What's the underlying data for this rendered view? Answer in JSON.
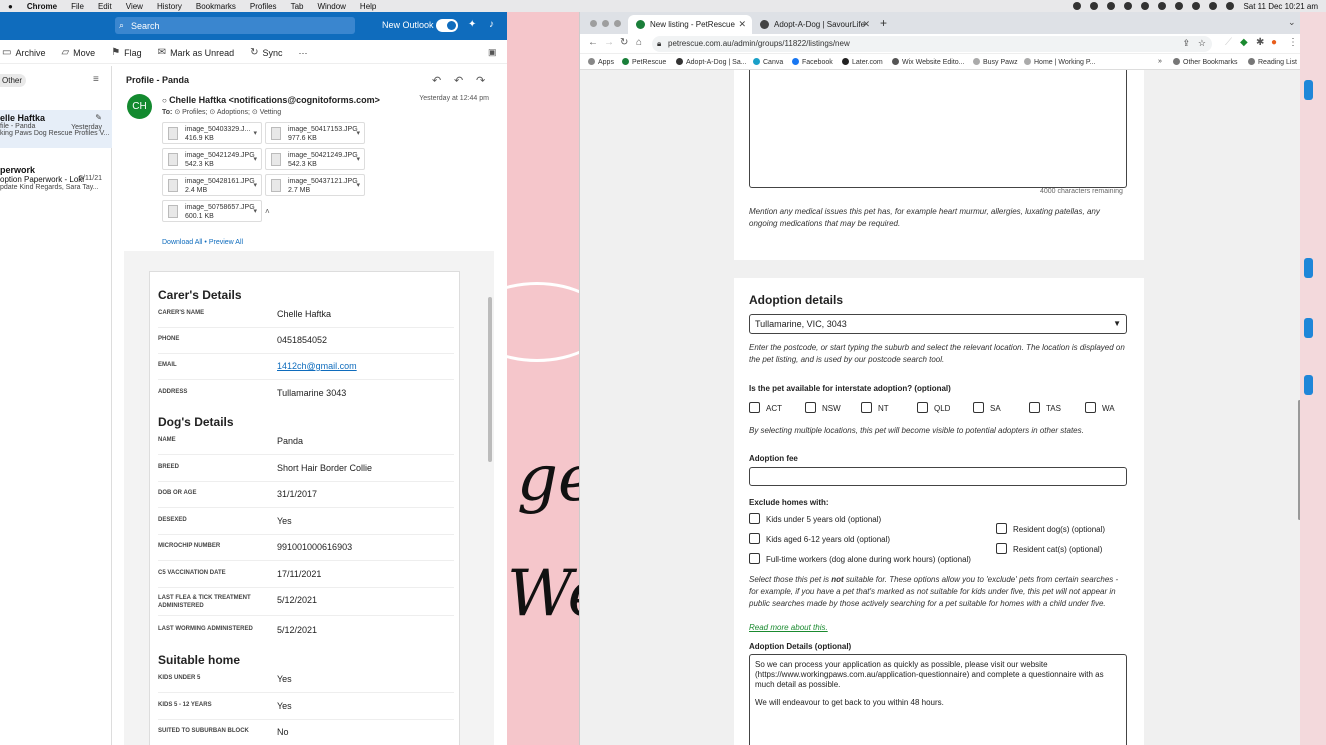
{
  "menubar": {
    "app": "Chrome",
    "items": [
      "File",
      "Edit",
      "View",
      "History",
      "Bookmarks",
      "Profiles",
      "Tab",
      "Window",
      "Help"
    ],
    "clock": "Sat 11 Dec  10:21 am"
  },
  "outlook": {
    "search_placeholder": "Search",
    "new_outlook": "New Outlook",
    "toolbar": {
      "archive": "Archive",
      "move": "Move",
      "flag": "Flag",
      "mark_unread": "Mark as Unread",
      "sync": "Sync",
      "more": "···"
    },
    "folder_pill": "Other",
    "mails": [
      {
        "name": "elle Haftka",
        "line1": "file - Panda",
        "line2": "king Paws Dog Rescue Profiles V...",
        "date": "Yesterday"
      },
      {
        "name": "perwork",
        "line1": "option Paperwork - Loki",
        "line2": "pdate Kind Regards, Sara Tay...",
        "date": "5/11/21"
      }
    ],
    "message": {
      "subject": "Profile - Panda",
      "avatar": "CH",
      "sender": "Chelle Haftka <notifications@cognitoforms.com>",
      "to_label": "To:",
      "recipients": [
        "Profiles;",
        "Adoptions;",
        "Vetting"
      ],
      "timestamp": "Yesterday at 12:44 pm",
      "attachments": [
        {
          "name": "image_50403329.J...",
          "size": "416.9 KB"
        },
        {
          "name": "image_50417153.JPG",
          "size": "977.6 KB"
        },
        {
          "name": "image_50421249.JPG",
          "size": "542.3 KB"
        },
        {
          "name": "image_50421249.JPG",
          "size": "542.3 KB"
        },
        {
          "name": "image_50428161.JPG",
          "size": "2.4 MB"
        },
        {
          "name": "image_50437121.JPG",
          "size": "2.7 MB"
        },
        {
          "name": "image_50758657.JPG",
          "size": "600.1 KB"
        }
      ],
      "download_all": "Download All",
      "preview_all": "• Preview All"
    },
    "form": {
      "carer_title": "Carer's Details",
      "dog_title": "Dog's Details",
      "home_title": "Suitable home",
      "carer": [
        {
          "label": "CARER'S NAME",
          "value": "Chelle Haftka"
        },
        {
          "label": "PHONE",
          "value": "0451854052"
        },
        {
          "label": "EMAIL",
          "value": "1412ch@gmail.com"
        },
        {
          "label": "ADDRESS",
          "value": "Tullamarine 3043"
        }
      ],
      "dog": [
        {
          "label": "NAME",
          "value": "Panda"
        },
        {
          "label": "BREED",
          "value": "Short Hair Border Collie"
        },
        {
          "label": "DOB OR AGE",
          "value": "31/1/2017"
        },
        {
          "label": "DESEXED",
          "value": "Yes"
        },
        {
          "label": "MICROCHIP NUMBER",
          "value": "991001000616903"
        },
        {
          "label": "C5 VACCINATION DATE",
          "value": "17/11/2021"
        },
        {
          "label": "LAST FLEA & TICK TREATMENT ADMINISTERED",
          "value": "5/12/2021"
        },
        {
          "label": "LAST WORMING ADMINISTERED",
          "value": "5/12/2021"
        }
      ],
      "home": [
        {
          "label": "KIDS UNDER 5",
          "value": "Yes"
        },
        {
          "label": "KIDS 5 - 12 YEARS",
          "value": "Yes"
        },
        {
          "label": "SUITED TO SUBURBAN BLOCK",
          "value": "No"
        }
      ]
    }
  },
  "chrome": {
    "tabs": [
      {
        "title": "New listing - PetRescue"
      },
      {
        "title": "Adopt-A-Dog | SavourLife"
      }
    ],
    "url": "petrescue.com.au/admin/groups/11822/listings/new",
    "bookmarks": [
      "Apps",
      "PetRescue",
      "Adopt-A-Dog | Sa...",
      "Canva",
      "Facebook",
      "Later.com",
      "Wix Website Edito...",
      "Busy Pawz",
      "Home | Working P...",
      "Other Bookmarks",
      "Reading List"
    ],
    "page": {
      "chars_remaining": "4000 characters remaining",
      "medical_hint": "Mention any medical issues this pet has, for example heart murmur, allergies, luxating patellas, any ongoing medications that may be required.",
      "adoption_title": "Adoption details",
      "location_value": "Tullamarine, VIC, 3043",
      "location_hint": "Enter the postcode, or start typing the suburb and select the relevant location. The location is displayed on the pet listing, and is used by our postcode search tool.",
      "interstate_label": "Is the pet available for interstate adoption? (optional)",
      "states": [
        "ACT",
        "NSW",
        "NT",
        "QLD",
        "SA",
        "TAS",
        "WA"
      ],
      "interstate_hint": "By selecting multiple locations, this pet will become visible to potential adopters in other states.",
      "fee_label": "Adoption fee",
      "exclude_label": "Exclude homes with:",
      "exclude_left": [
        "Kids under 5 years old (optional)",
        "Kids aged 6-12 years old (optional)",
        "Full-time workers (dog alone during work hours) (optional)"
      ],
      "exclude_right": [
        "Resident dog(s) (optional)",
        "Resident cat(s) (optional)"
      ],
      "exclude_hint_a": "Select those this pet is ",
      "exclude_hint_not": "not",
      "exclude_hint_b": " suitable for. These options allow you to 'exclude' pets from certain searches - for example, if you have a pet that's marked as not suitable for kids under five, this pet will not appear in public searches made by those actively searching for a pet suitable for homes with a child under five.",
      "read_more": "Read more about this.",
      "details_label": "Adoption Details (optional)",
      "details_text_1": "So we can process your application as quickly as possible, please visit our website (https://www.workingpaws.com.au/application-questionnaire) and complete a questionnaire with as much detail as possible.",
      "details_text_2": "We will endeavour to get back to you within 48 hours."
    }
  },
  "background_text": {
    "top": "ge",
    "bottom": "We"
  }
}
